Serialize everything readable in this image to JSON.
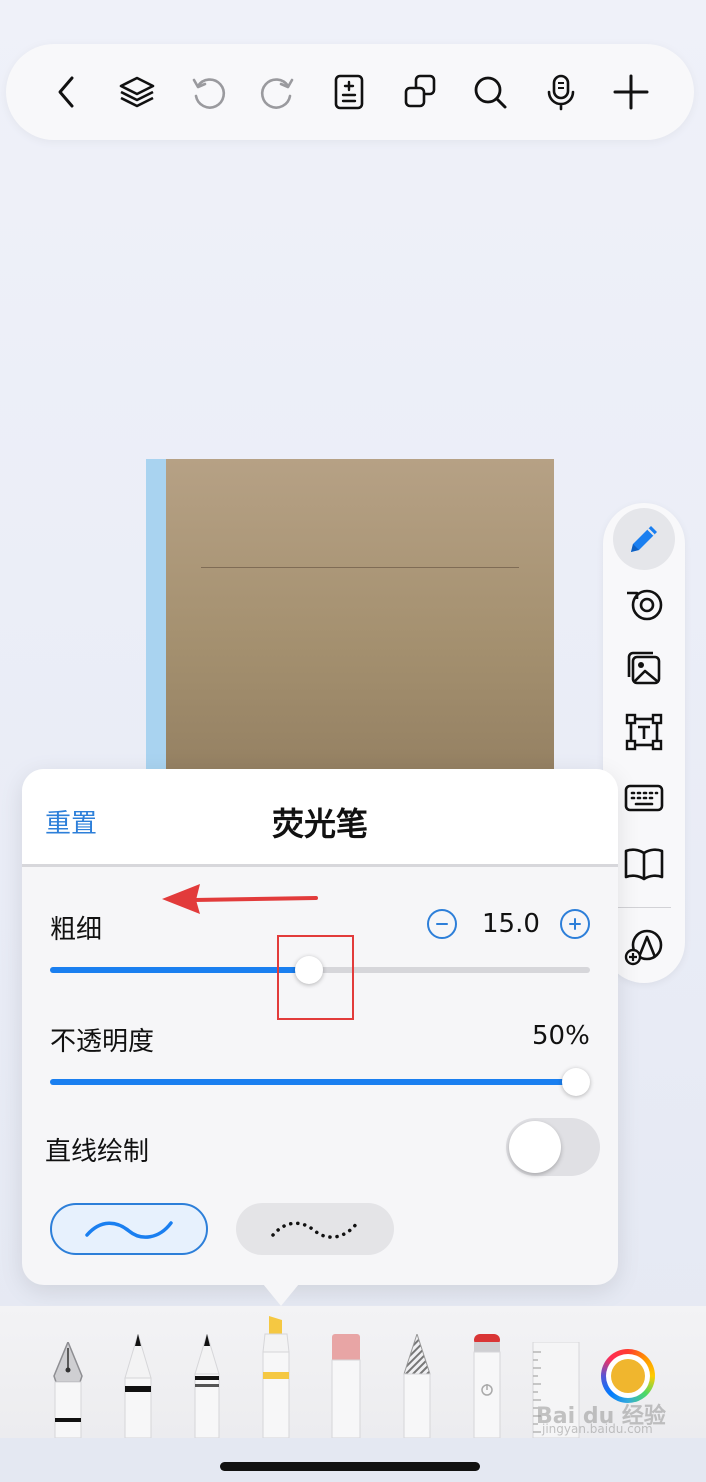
{
  "toolbar": {
    "buttons": [
      {
        "name": "back-button",
        "icon": "chevron-left-icon"
      },
      {
        "name": "layers-button",
        "icon": "layers-icon"
      },
      {
        "name": "undo-button",
        "icon": "undo-icon",
        "enabled": false
      },
      {
        "name": "redo-button",
        "icon": "redo-icon",
        "enabled": false
      },
      {
        "name": "page-settings-button",
        "icon": "page-add-icon"
      },
      {
        "name": "duplicate-button",
        "icon": "copy-icon"
      },
      {
        "name": "search-button",
        "icon": "search-icon"
      },
      {
        "name": "record-button",
        "icon": "microphone-icon"
      },
      {
        "name": "add-button",
        "icon": "plus-icon"
      }
    ]
  },
  "side_rail": {
    "tools": [
      {
        "name": "pen-tool",
        "icon": "pencil-icon",
        "active": true
      },
      {
        "name": "tape-tool",
        "icon": "tape-icon"
      },
      {
        "name": "image-tool",
        "icon": "image-icon"
      },
      {
        "name": "text-tool",
        "icon": "text-box-icon"
      },
      {
        "name": "keyboard-tool",
        "icon": "keyboard-icon"
      },
      {
        "name": "reader-tool",
        "icon": "book-icon"
      },
      {
        "name": "shapes-tool",
        "icon": "add-shape-icon"
      }
    ]
  },
  "popover": {
    "reset_label": "重置",
    "title": "荧光笔",
    "thickness": {
      "label": "粗细",
      "value": "15.0",
      "fraction": 0.48
    },
    "opacity": {
      "label": "不透明度",
      "value": "50%",
      "fraction": 1.0
    },
    "straight_line": {
      "label": "直线绘制",
      "on": false
    },
    "stroke_styles": [
      "smooth",
      "dotted"
    ],
    "selected_stroke": "smooth"
  },
  "pen_tray": {
    "tools": [
      {
        "name": "fountain-pen",
        "selected": false
      },
      {
        "name": "ballpoint-pen",
        "selected": false
      },
      {
        "name": "pencil",
        "selected": false
      },
      {
        "name": "highlighter",
        "selected": true,
        "color": "#f5c842"
      },
      {
        "name": "eraser",
        "selected": false
      },
      {
        "name": "texture-pencil",
        "selected": false
      },
      {
        "name": "lasso-eraser",
        "selected": false
      },
      {
        "name": "ruler",
        "selected": false
      }
    ],
    "current_color": "#f0b62e"
  },
  "watermark": {
    "main": "Bai du 经验",
    "sub": "jingyan.baidu.com"
  },
  "colors": {
    "accent": "#1a7ff0",
    "annotation": "#e23b3b"
  }
}
